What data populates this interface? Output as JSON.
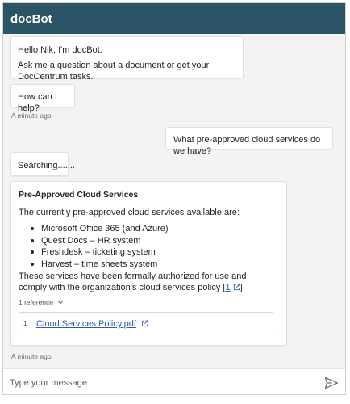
{
  "header": {
    "title": "docBot"
  },
  "messages": {
    "greeting": {
      "line1": "Hello Nik, I'm docBot.",
      "line2": "Ask me a question about a document or get your DocCentrum tasks."
    },
    "help": {
      "text": "How can I help?",
      "timestamp": "A minute ago"
    },
    "user_question": {
      "text": "What pre-approved cloud services do we have?"
    },
    "searching": {
      "text": "Searching......."
    },
    "answer": {
      "title": "Pre-Approved Cloud Services",
      "intro": "The currently pre-approved cloud services available are:",
      "services": [
        "Microsoft Office 365 (and Azure)",
        "Quest Docs – HR system",
        "Freshdesk – ticketing system",
        "Harvest – time sheets system"
      ],
      "closing": "These services have been formally authorized for use and comply with the organization's cloud services policy",
      "citation": "1",
      "closing_end": ".",
      "references_label": "1 reference",
      "reference": {
        "number": "1",
        "title": "Cloud Services Policy.pdf"
      },
      "timestamp": "A minute ago"
    }
  },
  "composer": {
    "placeholder": "Type your message"
  },
  "icons": {
    "external_link": "external-link-icon",
    "chevron": "chevron-down-icon",
    "send": "send-icon"
  },
  "colors": {
    "header_bg": "#2b5566",
    "chat_bg": "#f3f3f3",
    "link": "#2a5db0"
  }
}
